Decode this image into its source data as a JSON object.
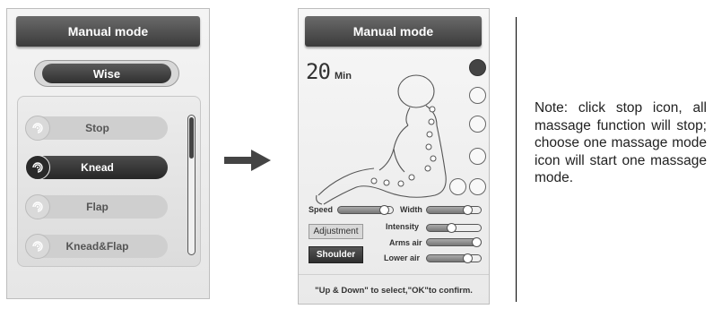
{
  "left_screen": {
    "title": "Manual mode",
    "selector_label": "Wise",
    "modes": [
      {
        "label": "Stop",
        "active": false
      },
      {
        "label": "Knead",
        "active": true
      },
      {
        "label": "Flap",
        "active": false
      },
      {
        "label": "Knead&Flap",
        "active": false
      }
    ]
  },
  "right_screen": {
    "title": "Manual mode",
    "timer_value": "20",
    "timer_unit": "Min",
    "controls": {
      "speed_label": "Speed",
      "width_label": "Width",
      "intensity_label": "Intensity",
      "arms_air_label": "Arms air",
      "lower_air_label": "Lower air",
      "adjustment_label": "Adjustment",
      "shoulder_label": "Shoulder"
    },
    "footer": "\"Up & Down\" to select,\"OK\"to confirm."
  },
  "note": "Note: click stop icon, all massage function will stop; choose one massage mode icon will start one massage mode.",
  "colors": {
    "dark": "#3b3b3b",
    "light": "#e6e6e6",
    "accent": "#ffffff"
  }
}
